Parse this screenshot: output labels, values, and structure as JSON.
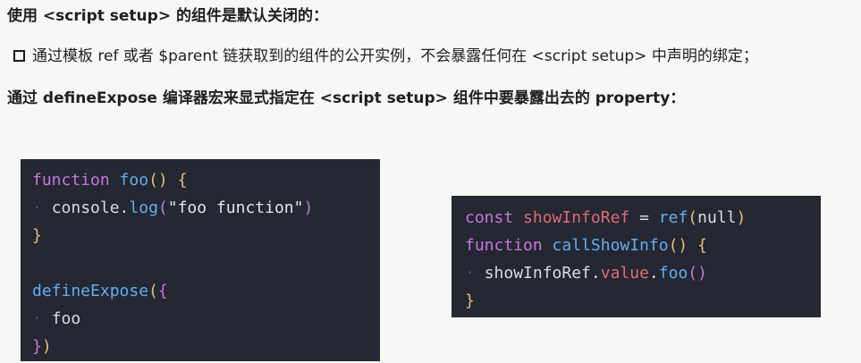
{
  "text": {
    "line1": "使用 <script setup> 的组件是默认关闭的：",
    "line2": "通过模板 ref 或者 $parent 链获取到的组件的公开实例，不会暴露任何在 <script setup> 中声明的绑定；",
    "line3": "通过 defineExpose 编译器宏来显式指定在 <script setup> 组件中要暴露出去的 property："
  },
  "code_left": {
    "l1_kw": "function",
    "l1_fn": "foo",
    "l1_paren": "()",
    "l1_brace": "{",
    "l2_obj": "console.",
    "l2_fn": "log",
    "l2_p1": "(",
    "l2_str": "\"foo function\"",
    "l2_p2": ")",
    "l3_brace": "}",
    "l5_fn": "defineExpose",
    "l5_p": "(",
    "l5_b": "{",
    "l6_id": "foo",
    "l7_b": "}",
    "l7_p": ")"
  },
  "code_right": {
    "l1_kw": "const",
    "l1_var": "showInfoRef",
    "l1_op": "=",
    "l1_fn": "ref",
    "l1_p1": "(",
    "l1_null": "null",
    "l1_p2": ")",
    "l2_kw": "function",
    "l2_fn": "callShowInfo",
    "l2_paren": "()",
    "l2_brace": "{",
    "l3_obj": "showInfoRef.",
    "l3_prop": "value",
    "l3_dot": ".",
    "l3_fn": "foo",
    "l3_paren": "()",
    "l4_brace": "}"
  }
}
